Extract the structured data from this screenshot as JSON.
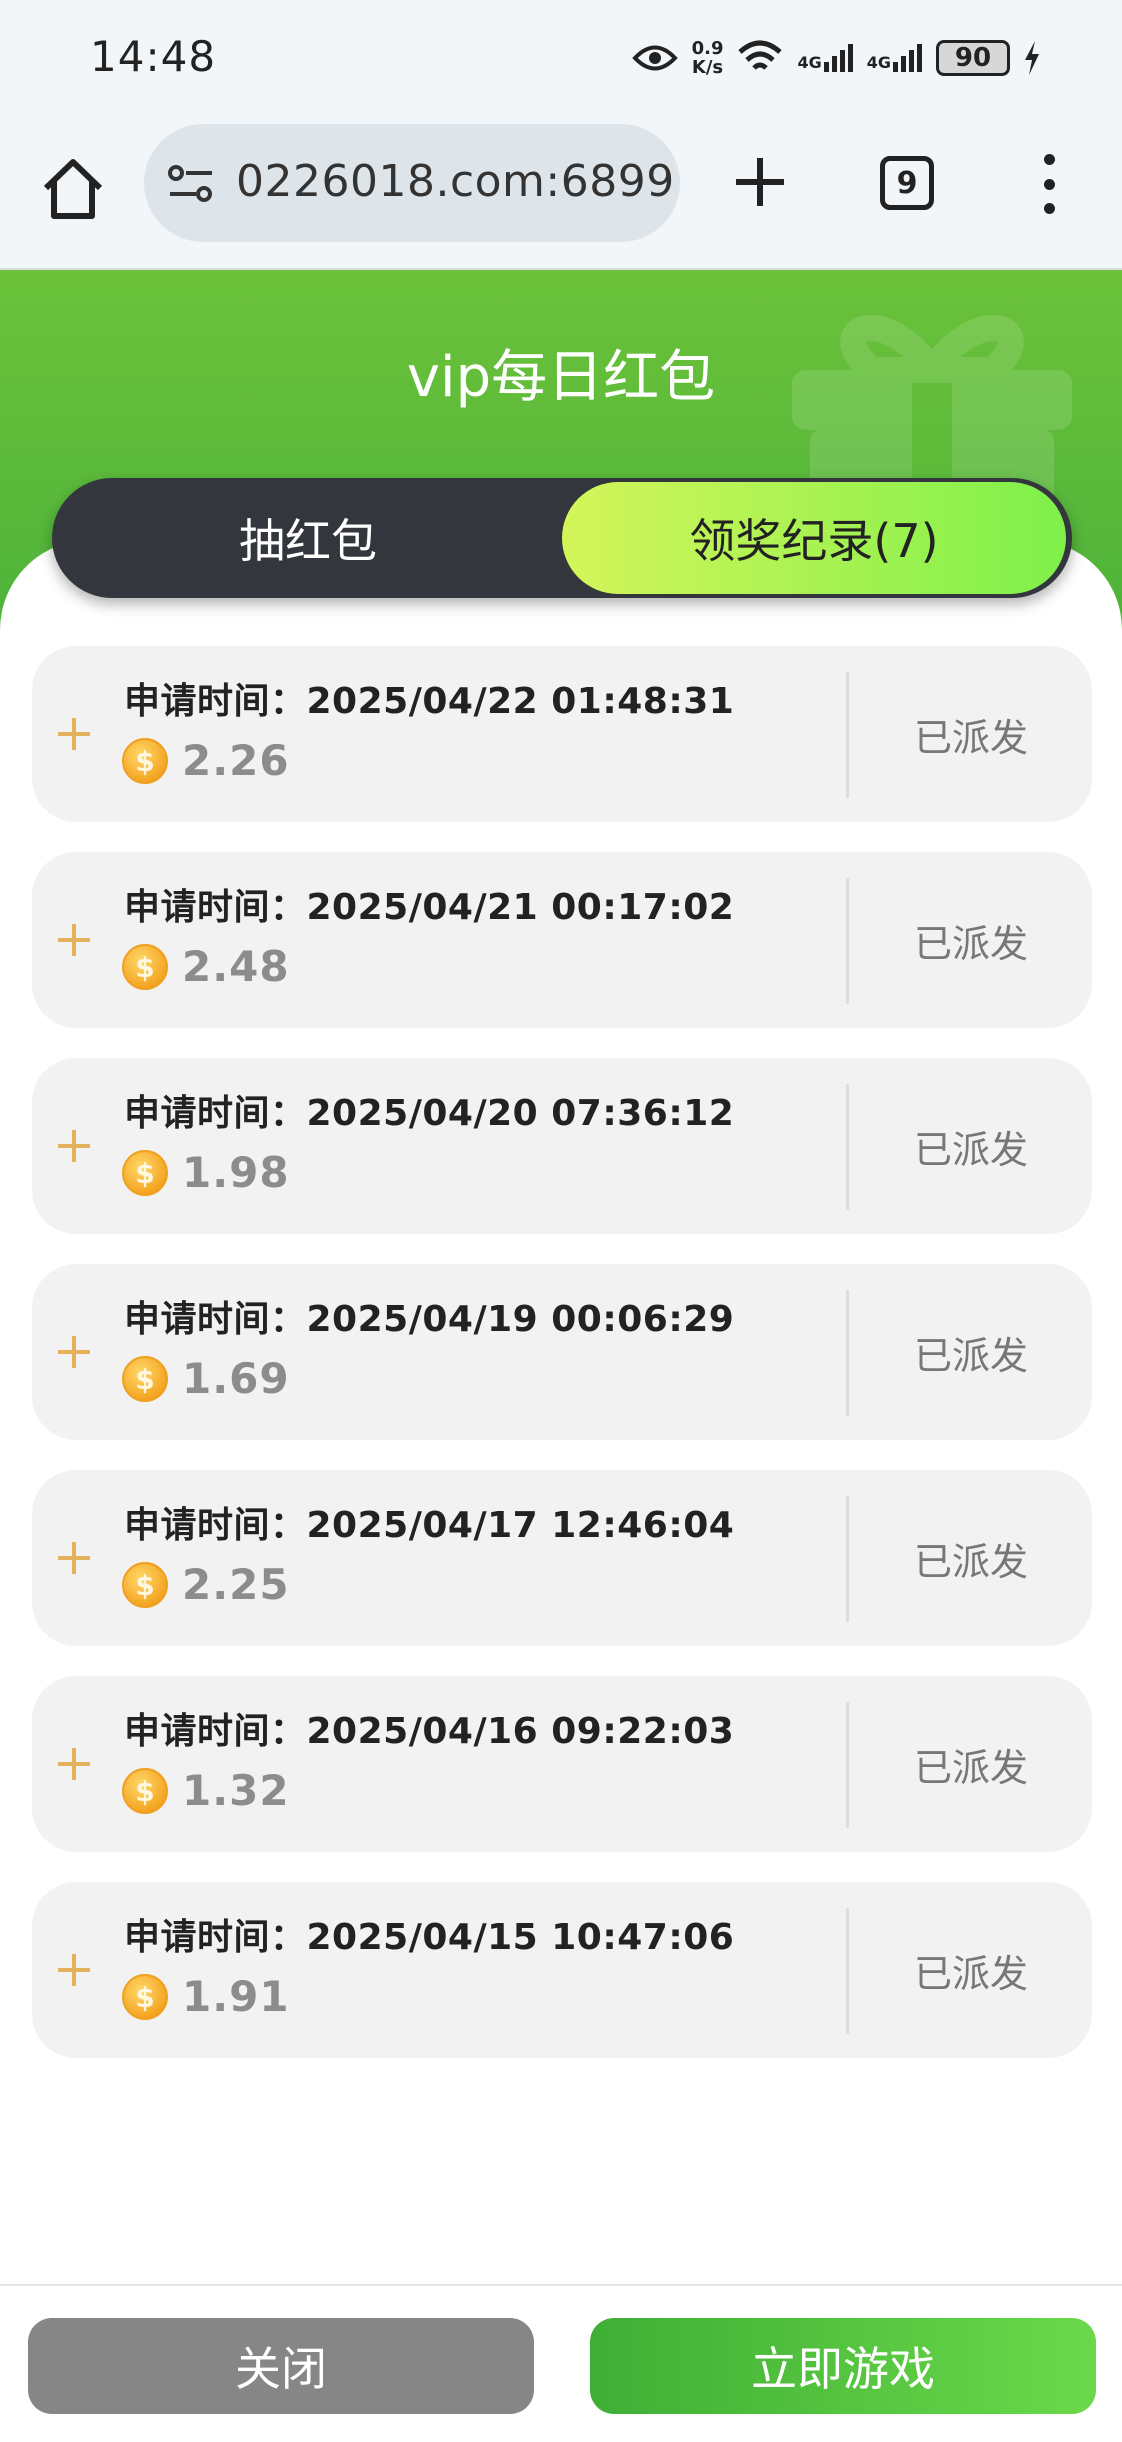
{
  "status_bar": {
    "time": "14:48",
    "net_speed_value": "0.9",
    "net_speed_unit": "K/s",
    "network1": "4G",
    "network2": "4G",
    "battery": "90"
  },
  "browser": {
    "url": "0226018.com:6899",
    "tab_count": "9"
  },
  "header": {
    "title": "vip每日红包"
  },
  "tabs": {
    "draw": "抽红包",
    "records": "领奖纪录(7)",
    "active": "records"
  },
  "records": [
    {
      "time": "申请时间：2025/04/22 01:48:31",
      "amount": "2.26",
      "status": "已派发"
    },
    {
      "time": "申请时间：2025/04/21 00:17:02",
      "amount": "2.48",
      "status": "已派发"
    },
    {
      "time": "申请时间：2025/04/20 07:36:12",
      "amount": "1.98",
      "status": "已派发"
    },
    {
      "time": "申请时间：2025/04/19 00:06:29",
      "amount": "1.69",
      "status": "已派发"
    },
    {
      "time": "申请时间：2025/04/17 12:46:04",
      "amount": "2.25",
      "status": "已派发"
    },
    {
      "time": "申请时间：2025/04/16 09:22:03",
      "amount": "1.32",
      "status": "已派发"
    },
    {
      "time": "申请时间：2025/04/15 10:47:06",
      "amount": "1.91",
      "status": "已派发"
    }
  ],
  "footer": {
    "close": "关闭",
    "play": "立即游戏"
  },
  "colors": {
    "header_green": "#4cb23a",
    "tab_active": "#a8f250",
    "plus_icon": "#e3b25a",
    "coin": "#f4a623"
  },
  "icons": {
    "coin": "dollar-coin-icon",
    "expand": "plus-icon"
  }
}
